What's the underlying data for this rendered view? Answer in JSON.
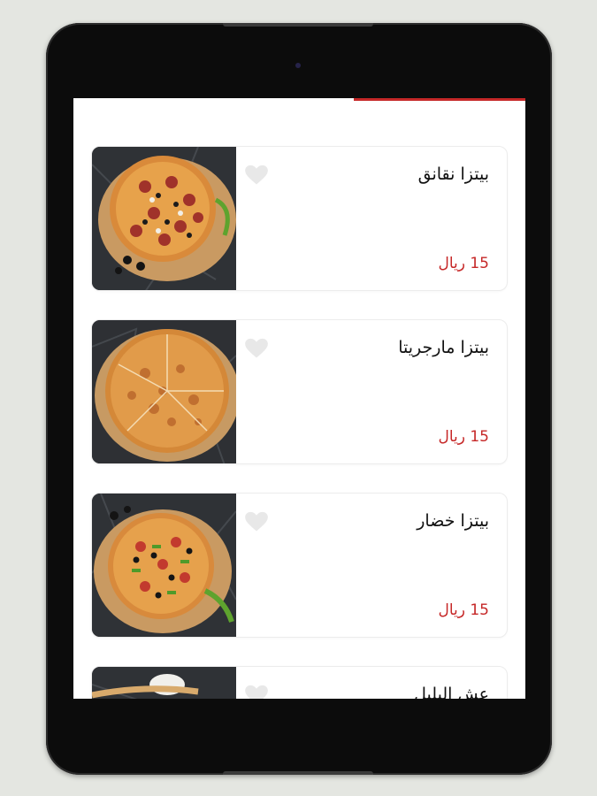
{
  "accent_color": "#c62828",
  "products": [
    {
      "name": "بيتزا نقانق",
      "price": "15 ريال",
      "image": "sausage-pizza-image",
      "favorite_icon": "heart-icon"
    },
    {
      "name": "بيتزا مارجريتا",
      "price": "15 ريال",
      "image": "margherita-pizza-image",
      "favorite_icon": "heart-icon"
    },
    {
      "name": "بيتزا خضار",
      "price": "15 ريال",
      "image": "vegetable-pizza-image",
      "favorite_icon": "heart-icon"
    },
    {
      "name": "عش البلبل",
      "price": "",
      "image": "dessert-image",
      "favorite_icon": "heart-icon"
    }
  ]
}
